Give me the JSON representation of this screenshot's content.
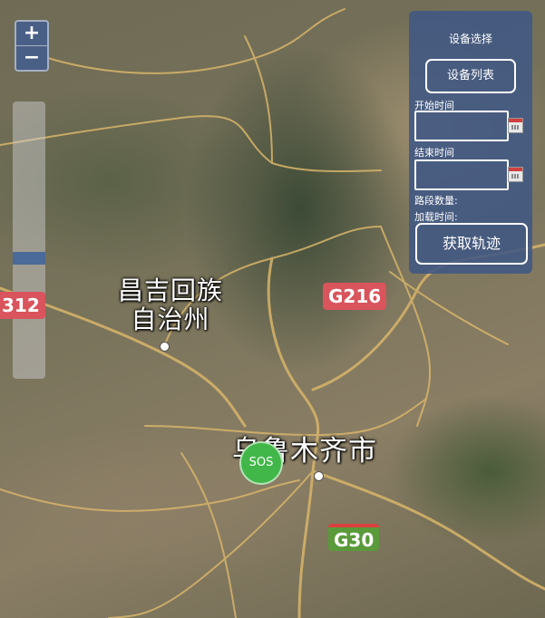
{
  "map": {
    "zoom_in": "+",
    "zoom_out": "−",
    "zoom_level_fraction": 0.57,
    "labels": {
      "prefecture": "昌吉回族\n自治州",
      "city": "乌鲁木齐市"
    },
    "shields": {
      "g216": "G216",
      "g30": "G30",
      "g312": "312"
    },
    "colors": {
      "national_road_shield": "#d9545c",
      "expressway_shield": "#5a9a3a",
      "expressway_top": "#d94040",
      "road": "#d8b56a"
    },
    "marker": {
      "text": "SOS",
      "color": "#41b649"
    }
  },
  "panel": {
    "title": "设备选择",
    "device_list_button": "设备列表",
    "start_time_label": "开始时间",
    "start_time_value": "",
    "end_time_label": "结束时间",
    "end_time_value": "",
    "segment_count_label": "路段数量:",
    "load_time_label": "加载时间:",
    "get_track_button": "获取轨迹",
    "calendar_icon": "calendar-icon"
  }
}
